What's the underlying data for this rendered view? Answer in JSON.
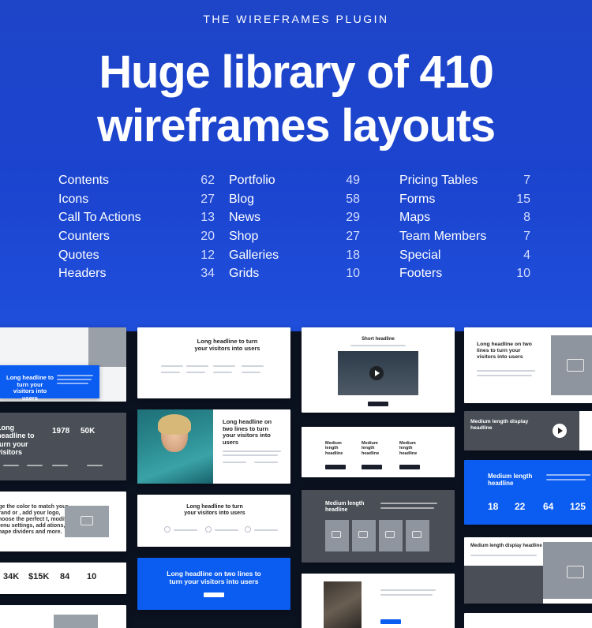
{
  "hero": {
    "eyebrow": "THE WIREFRAMES PLUGIN",
    "title_line1": "Huge library of 410",
    "title_line2": "wireframes layouts"
  },
  "categories": [
    [
      {
        "name": "Contents",
        "count": "62"
      },
      {
        "name": "Icons",
        "count": "27"
      },
      {
        "name": "Call To Actions",
        "count": "13"
      },
      {
        "name": "Counters",
        "count": "20"
      },
      {
        "name": "Quotes",
        "count": "12"
      },
      {
        "name": "Headers",
        "count": "34"
      }
    ],
    [
      {
        "name": "Portfolio",
        "count": "49"
      },
      {
        "name": "Blog",
        "count": "58"
      },
      {
        "name": "News",
        "count": "29"
      },
      {
        "name": "Shop",
        "count": "27"
      },
      {
        "name": "Galleries",
        "count": "18"
      },
      {
        "name": "Grids",
        "count": "10"
      }
    ],
    [
      {
        "name": "Pricing Tables",
        "count": "7"
      },
      {
        "name": "Forms",
        "count": "15"
      },
      {
        "name": "Maps",
        "count": "8"
      },
      {
        "name": "Team Members",
        "count": "7"
      },
      {
        "name": "Special",
        "count": "4"
      },
      {
        "name": "Footers",
        "count": "10"
      }
    ]
  ],
  "thumbs": {
    "t1": "Long headline to turn your visitors into users",
    "t2": "Long headline to turn your visitors into users",
    "t3": "Short headline",
    "t4": "Long headline on two lines to turn your visitors into users",
    "t5": "Long headline to turn your visitors",
    "t5_stats": [
      "1978",
      "50K"
    ],
    "t6": "Long headline on two lines to turn your visitors into users",
    "t7_cols": [
      "Medium length headline",
      "Medium length headline",
      "Medium length headline"
    ],
    "t8": "Medium length display headline",
    "t9": "nge the color to match your brand or , add your logo, choose the perfect t, modify menu settings, add ations, add shape dividers and more.",
    "t10": "Long headline to turn your visitors into users",
    "t11": "Medium length headline",
    "t12": "Medium length headline",
    "t12_stats": [
      "18",
      "22",
      "64",
      "125"
    ],
    "t13_stats": [
      "34K",
      "$15K",
      "84",
      "10"
    ],
    "t14": "Long headline on two lines to turn your visitors into users",
    "t15": "Medium length display headline"
  },
  "colors": {
    "hero_blue": "#1b44cf",
    "accent_blue": "#0b5cf0",
    "dark_panel": "#4a4f57"
  }
}
